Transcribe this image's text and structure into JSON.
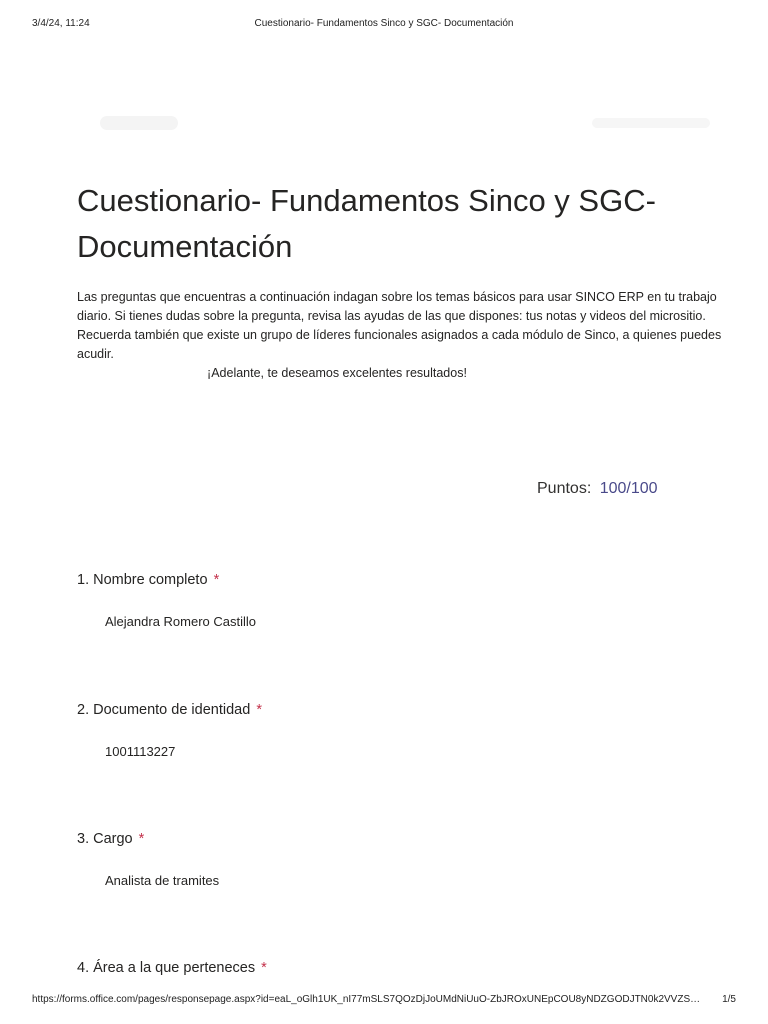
{
  "print_header": {
    "datetime": "3/4/24, 11:24",
    "doc_title": "Cuestionario- Fundamentos Sinco y SGC- Documentación"
  },
  "form": {
    "title": "Cuestionario- Fundamentos Sinco y SGC- Documentación",
    "description": "Las preguntas que encuentras a continuación indagan sobre los temas básicos para usar SINCO ERP en tu trabajo diario.  Si tienes dudas sobre la pregunta, revisa las ayudas de las que dispones: tus notas y videos del micrositio. Recuerda también que existe un grupo de líderes funcionales asignados a cada módulo de Sinco, a quienes puedes acudir.",
    "cheer": "¡Adelante, te deseamos excelentes resultados!"
  },
  "score": {
    "label": "Puntos:",
    "value": "100/100"
  },
  "questions": [
    {
      "number": "1.",
      "title": "Nombre completo",
      "required_mark": "*",
      "answer": "Alejandra Romero Castillo"
    },
    {
      "number": "2.",
      "title": "Documento de identidad",
      "required_mark": "*",
      "answer": "1001113227"
    },
    {
      "number": "3.",
      "title": "Cargo",
      "required_mark": "*",
      "answer": "Analista de tramites"
    },
    {
      "number": "4.",
      "title": "Área a la que perteneces",
      "required_mark": "*"
    }
  ],
  "print_footer": {
    "url": "https://forms.office.com/pages/responsepage.aspx?id=eaL_oGlh1UK_nI77mSLS7QOzDjJoUMdNiUuO-ZbJROxUNEpCOU8yNDZGODJTN0k2VVZS…",
    "page": "1/5"
  }
}
